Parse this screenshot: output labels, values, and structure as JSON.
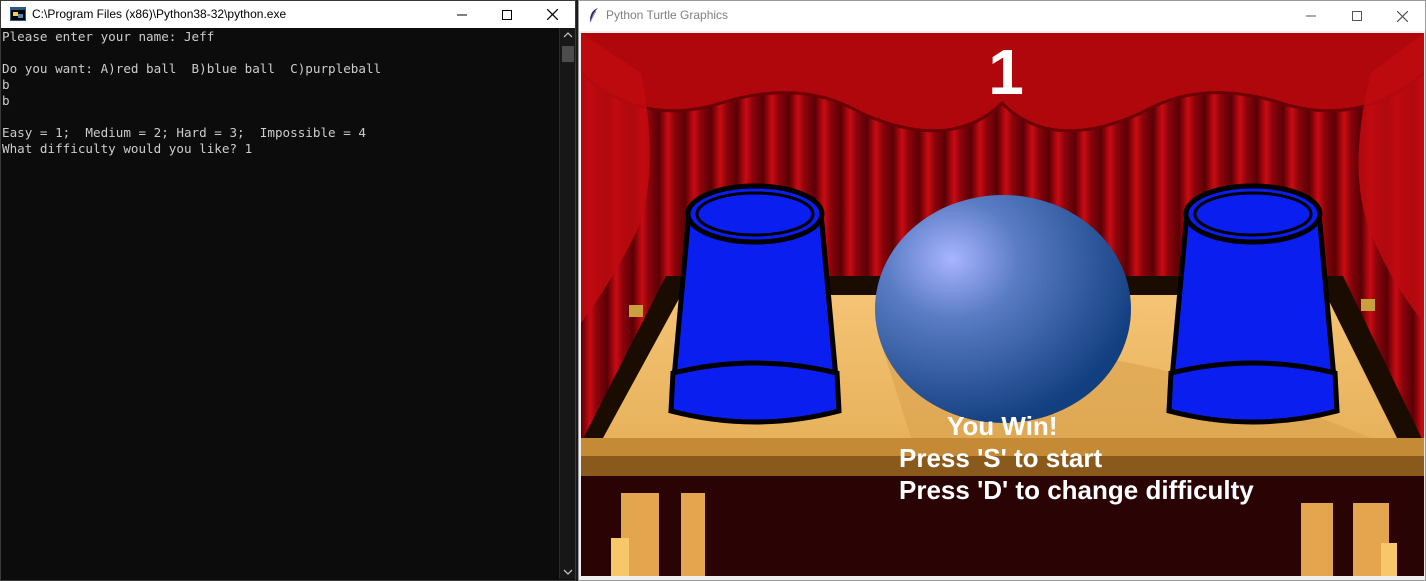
{
  "console": {
    "title": "C:\\Program Files (x86)\\Python38-32\\python.exe",
    "icon": "python-console-icon",
    "lines": [
      "Please enter your name: Jeff",
      "",
      "Do you want: A)red ball  B)blue ball  C)purpleball",
      "b",
      "b",
      "",
      "Easy = 1;  Medium = 2; Hard = 3;  Impossible = 4",
      "What difficulty would you like? 1"
    ]
  },
  "turtle": {
    "title": "Python Turtle Graphics",
    "icon": "feather-icon",
    "score": "1",
    "messages": {
      "win": "You Win!",
      "start": "Press 'S' to start",
      "difficulty": "Press 'D' to change difficulty"
    },
    "colors": {
      "cup": "#0a1ef0",
      "ball": "#2a5296",
      "curtain": "#b3070d",
      "table": "#f0c070"
    }
  }
}
